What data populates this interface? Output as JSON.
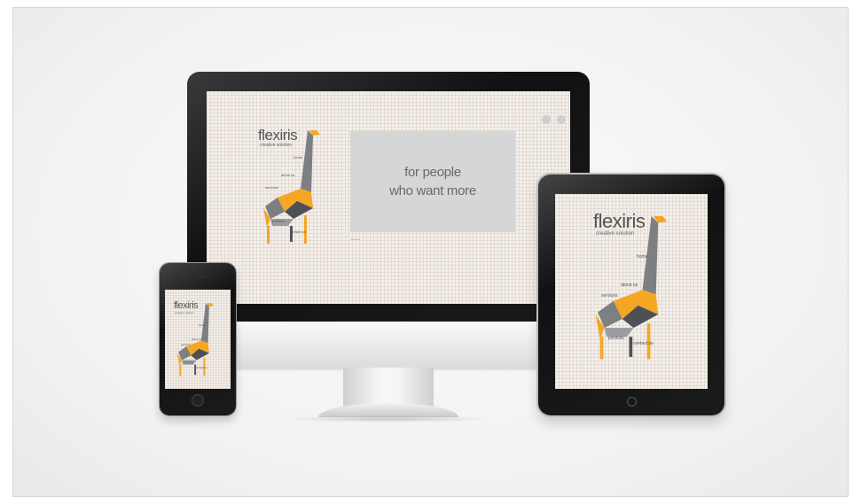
{
  "showcase": {
    "desktop": {
      "brand": "flexiris",
      "tagline": "creative solution",
      "nav": [
        "home",
        "about us",
        "services",
        "portfolio",
        "contact us"
      ],
      "hero_line1": "for people",
      "hero_line2": "who want more",
      "slider_dots": "••••"
    },
    "tablet": {
      "brand": "flexiris",
      "tagline": "creative solution",
      "nav": [
        "home",
        "about us",
        "services",
        "portfolio",
        "contact us"
      ]
    },
    "phone": {
      "brand": "flexiris",
      "tagline": "creative solution",
      "nav": [
        "home",
        "about us",
        "services",
        "portfolio",
        "contact us"
      ]
    }
  },
  "colors": {
    "accent_orange": "#f5a623",
    "giraffe_grey": "#7d7f83",
    "giraffe_dark": "#4e5055",
    "device_black": "#141414",
    "screen_bg": "#f4efea",
    "hero_bg": "#d6d6d6"
  },
  "icons": [
    "globe-icon",
    "share-icon",
    "home-button-icon"
  ]
}
